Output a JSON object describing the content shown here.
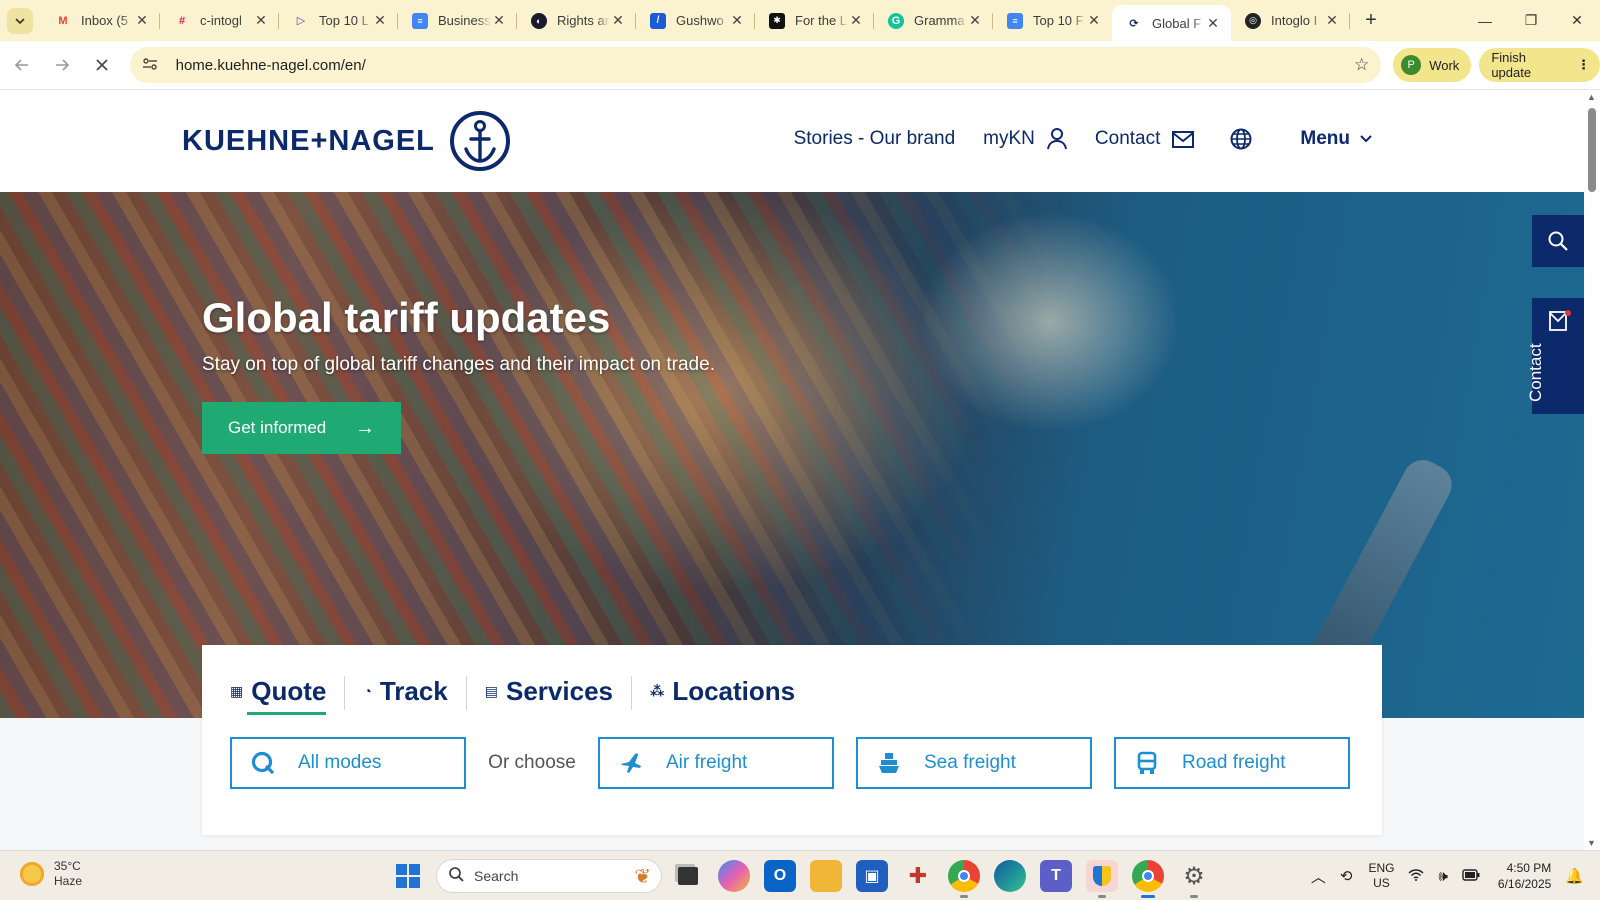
{
  "browser": {
    "tabs": [
      {
        "title": "Inbox (5",
        "icon": "gmail-icon",
        "color": "#ea4335"
      },
      {
        "title": "c-intogl",
        "icon": "slack-icon",
        "color": "#4a154b"
      },
      {
        "title": "Top 10 L",
        "icon": "play-icon",
        "color": "#6b2fb3"
      },
      {
        "title": "Business",
        "icon": "docs-icon",
        "color": "#4285f4"
      },
      {
        "title": "Rights ar",
        "icon": "circle-icon",
        "color": "#1a1a2e"
      },
      {
        "title": "Gushwo",
        "icon": "pen-icon",
        "color": "#1c5bd6"
      },
      {
        "title": "For the L",
        "icon": "tile-icon",
        "color": "#111"
      },
      {
        "title": "Gramma",
        "icon": "grammarly-icon",
        "color": "#15c39a"
      },
      {
        "title": "Top 10 F",
        "icon": "docs-icon",
        "color": "#4285f4"
      },
      {
        "title": "Global F",
        "icon": "kn-icon",
        "color": "#0c2a6b",
        "active": true
      },
      {
        "title": "Intoglo I",
        "icon": "intoglo-icon",
        "color": "#222"
      }
    ],
    "url": "home.kuehne-nagel.com/en/",
    "profile_label": "Work",
    "profile_initial": "P",
    "update_label": "Finish update"
  },
  "site": {
    "logo_text": "KUEHNE+NAGEL",
    "nav": {
      "stories": "Stories - Our brand",
      "mykn": "myKN",
      "contact": "Contact",
      "menu": "Menu"
    },
    "hero": {
      "title": "Global tariff updates",
      "subtitle": "Stay on top of global tariff changes and their impact on trade.",
      "cta": "Get informed"
    },
    "float_contact": "Contact",
    "quote": {
      "tabs": [
        "Quote",
        "Track",
        "Services",
        "Locations"
      ],
      "all_modes": "All modes",
      "or_choose": "Or choose",
      "modes": [
        "Air freight",
        "Sea freight",
        "Road freight"
      ]
    }
  },
  "taskbar": {
    "weather_temp": "35°C",
    "weather_desc": "Haze",
    "search_placeholder": "Search",
    "lang_top": "ENG",
    "lang_bottom": "US",
    "time": "4:50 PM",
    "date": "6/16/2025"
  },
  "colors": {
    "brand_navy": "#0c2a6b",
    "cta_green": "#1eaa72",
    "mode_blue": "#1d8fd0",
    "chrome_yellow": "#fbf3cf"
  }
}
